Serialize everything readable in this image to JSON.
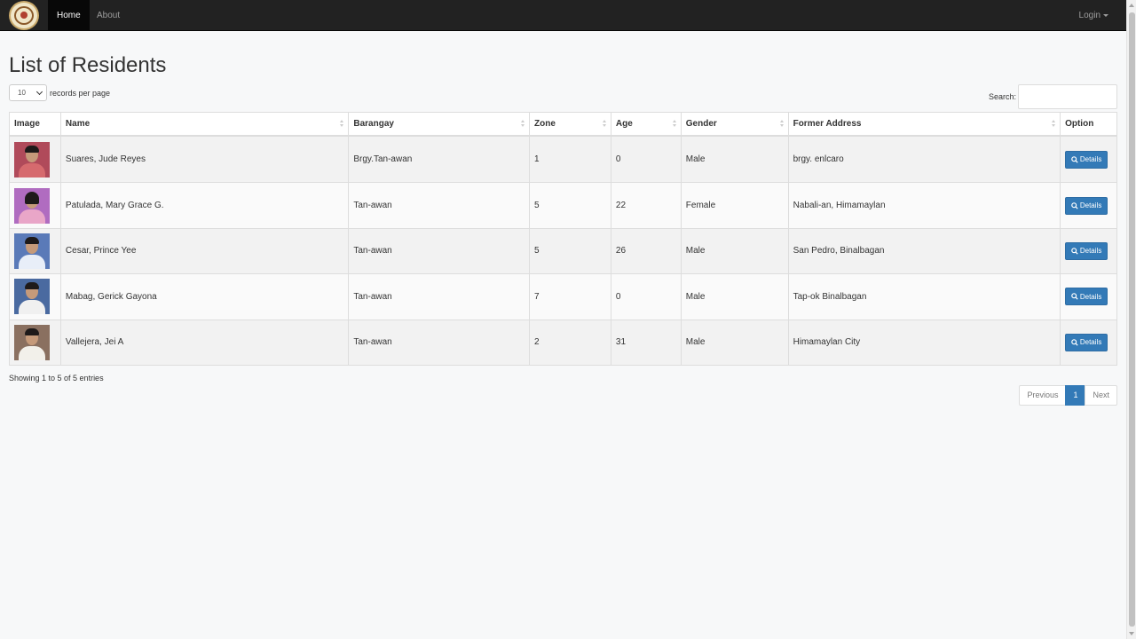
{
  "nav": {
    "home": "Home",
    "about": "About",
    "login": "Login"
  },
  "page": {
    "title": "List of Residents",
    "length_value": "10",
    "length_label": "records per page",
    "search_label": "Search:",
    "search_value": ""
  },
  "table": {
    "headers": {
      "image": "Image",
      "name": "Name",
      "barangay": "Barangay",
      "zone": "Zone",
      "age": "Age",
      "gender": "Gender",
      "former_address": "Former Address",
      "option": "Option"
    },
    "rows": [
      {
        "name": "Suares, Jude Reyes",
        "barangay": "Brgy.Tan-awan",
        "zone": "1",
        "age": "0",
        "gender": "Male",
        "former_address": "brgy. enlcaro",
        "button": "Details"
      },
      {
        "name": "Patulada, Mary Grace G.",
        "barangay": "Tan-awan",
        "zone": "5",
        "age": "22",
        "gender": "Female",
        "former_address": "Nabali-an, Himamaylan",
        "button": "Details"
      },
      {
        "name": "Cesar, Prince Yee",
        "barangay": "Tan-awan",
        "zone": "5",
        "age": "26",
        "gender": "Male",
        "former_address": "San Pedro, Binalbagan",
        "button": "Details"
      },
      {
        "name": "Mabag, Gerick Gayona",
        "barangay": "Tan-awan",
        "zone": "7",
        "age": "0",
        "gender": "Male",
        "former_address": "Tap-ok Binalbagan",
        "button": "Details"
      },
      {
        "name": "Vallejera, Jei A",
        "barangay": "Tan-awan",
        "zone": "2",
        "age": "31",
        "gender": "Male",
        "former_address": "Himamaylan City",
        "button": "Details"
      }
    ]
  },
  "footer": {
    "info": "Showing 1 to 5 of 5 entries",
    "previous": "Previous",
    "page": "1",
    "next": "Next"
  },
  "colors": {
    "navbar": "#222222",
    "primary": "#337ab7",
    "photo_backgrounds": [
      "#b04a5a",
      "#b06cc0",
      "#5a7ab8",
      "#4a6aa0",
      "#8a7060"
    ]
  }
}
